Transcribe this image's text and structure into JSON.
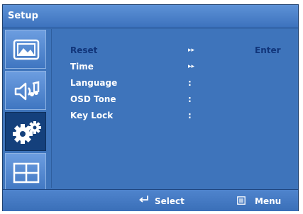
{
  "header": {
    "title": "Setup"
  },
  "sidebar": {
    "tabs": [
      {
        "name": "picture",
        "icon": "picture-icon"
      },
      {
        "name": "audio",
        "icon": "audio-icon"
      },
      {
        "name": "setup",
        "icon": "gears-icon",
        "active": true
      },
      {
        "name": "layout",
        "icon": "grid-icon"
      }
    ]
  },
  "menu": {
    "items": [
      {
        "label": "Reset",
        "separator": "▸▸",
        "value": "Enter",
        "highlighted": true
      },
      {
        "label": "Time",
        "separator": "▸▸",
        "value": ""
      },
      {
        "label": "Language",
        "separator": ":",
        "value": ""
      },
      {
        "label": "OSD Tone",
        "separator": ":",
        "value": ""
      },
      {
        "label": "Key Lock",
        "separator": ":",
        "value": ""
      }
    ]
  },
  "footer": {
    "select_label": "Select",
    "select_icon": "enter-icon",
    "menu_label": "Menu",
    "menu_icon": "menu-icon"
  },
  "colors": {
    "background": "#3e74bb",
    "highlight_text": "#11357a",
    "active_tab": "#14407c"
  }
}
